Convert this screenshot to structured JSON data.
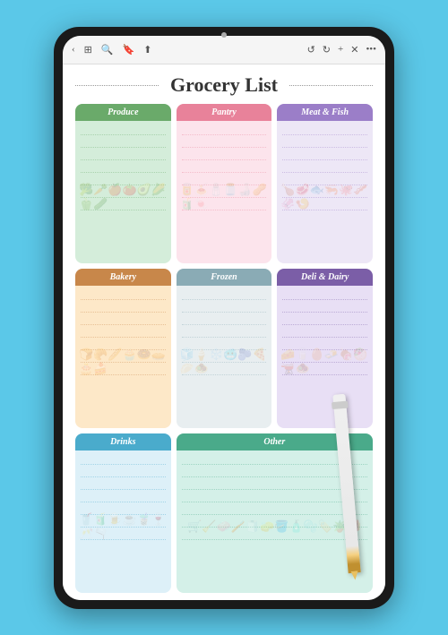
{
  "app": {
    "title": "Grocery List"
  },
  "toolbar": {
    "left_icons": [
      "back-icon",
      "grid-icon",
      "search-icon",
      "bookmark-icon",
      "share-icon"
    ],
    "right_icons": [
      "undo-icon",
      "redo-icon",
      "add-icon",
      "close-icon",
      "more-icon"
    ]
  },
  "categories": [
    {
      "id": "produce",
      "label": "Produce",
      "header_color": "#6aaa6a",
      "body_color": "#d4edda",
      "icons": [
        "🥦",
        "🥕",
        "🍎",
        "🍅",
        "🥑",
        "🌽"
      ],
      "col": 1,
      "row": 1
    },
    {
      "id": "pantry",
      "label": "Pantry",
      "header_color": "#e8829a",
      "body_color": "#fce4ec",
      "icons": [
        "🥫",
        "🍝",
        "🧂",
        "🫙",
        "🍶"
      ],
      "col": 2,
      "row": 1
    },
    {
      "id": "meat",
      "label": "Meat & Fish",
      "header_color": "#9b7ec8",
      "body_color": "#ede7f6",
      "icons": [
        "🍗",
        "🥩",
        "🐟",
        "🦐"
      ],
      "col": 3,
      "row": 1
    },
    {
      "id": "bakery",
      "label": "Bakery",
      "header_color": "#c8874a",
      "body_color": "#fde8c8",
      "icons": [
        "🍞",
        "🥐",
        "🥖",
        "🧁",
        "🍩"
      ],
      "col": 1,
      "row": 2
    },
    {
      "id": "frozen",
      "label": "Frozen",
      "header_color": "#8aabb5",
      "body_color": "#e8eef0",
      "icons": [
        "🧊",
        "🍦",
        "❄️",
        "🥶"
      ],
      "col": 2,
      "row": 2
    },
    {
      "id": "deli",
      "label": "Deli & Dairy",
      "header_color": "#7b5ea7",
      "body_color": "#e8dff5",
      "icons": [
        "🧀",
        "🥛",
        "🥚",
        "🧈"
      ],
      "col": 3,
      "row": 2
    },
    {
      "id": "drinks",
      "label": "Drinks",
      "header_color": "#4aabcc",
      "body_color": "#ddf0f8",
      "icons": [
        "🥤",
        "🧃",
        "🍺",
        "☕",
        "🧋"
      ],
      "col": 1,
      "row": 3
    },
    {
      "id": "other",
      "label": "Other",
      "header_color": "#4aaa8a",
      "body_color": "#d4f0e8",
      "icons": [
        "🛒",
        "🧹",
        "🧼",
        "🪥",
        "🧻"
      ],
      "col": "2-4",
      "row": 3
    }
  ]
}
